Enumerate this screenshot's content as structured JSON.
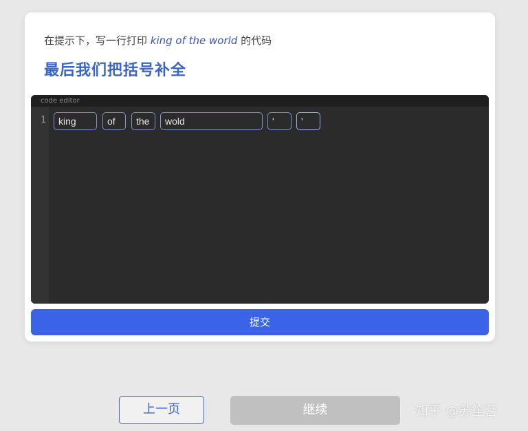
{
  "prompt": {
    "prefix": "在提示下，写一行打印 ",
    "emphasis": "king of the world",
    "suffix": " 的代码"
  },
  "heading": "最后我们把括号补全",
  "editor": {
    "label": "code editor",
    "line_number": "1",
    "tokens": [
      "king",
      "of",
      "the",
      "wold",
      "'",
      "'"
    ]
  },
  "submit_label": "提交",
  "nav": {
    "prev_label": "上一页",
    "continue_label": "继续"
  },
  "watermark": "知乎 @苏笙䓘",
  "colors": {
    "accent": "#3a63e8",
    "heading": "#3a64c9",
    "editor_bg": "#2b2b2b",
    "disabled": "#c0c0c0"
  }
}
